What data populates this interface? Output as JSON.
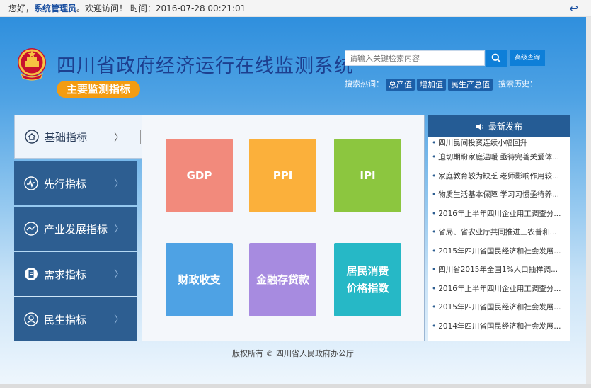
{
  "topbar": {
    "greeting": "您好，",
    "admin": "系统管理员",
    "welcome": "。欢迎访问！ 时间：",
    "time": "2016-07-28 00:21:01",
    "logout_icon": "↩"
  },
  "header": {
    "title": "四川省政府经济运行在线监测系统",
    "badge": "主要监测指标",
    "emblem_icon": "national-emblem-icon"
  },
  "search": {
    "placeholder": "请输入关键检索内容",
    "advanced_label": "高级查询",
    "hot_label": "搜索热词：",
    "hot_tags": [
      "总产值",
      "增加值",
      "民生产总值"
    ],
    "history_label": "搜索历史："
  },
  "nav": {
    "items": [
      {
        "label": "基础指标",
        "icon": "home-icon",
        "chevron": "〉"
      },
      {
        "label": "先行指标",
        "icon": "pulse-icon",
        "chevron": "〉"
      },
      {
        "label": "产业发展指标",
        "icon": "trend-icon",
        "chevron": "〉"
      },
      {
        "label": "需求指标",
        "icon": "document-icon",
        "chevron": "〉"
      },
      {
        "label": "民生指标",
        "icon": "user-icon",
        "chevron": "〉"
      }
    ]
  },
  "tiles": [
    {
      "label": "GDP",
      "color": "#f28a7c"
    },
    {
      "label": "PPI",
      "color": "#fbb03b"
    },
    {
      "label": "IPI",
      "color": "#8cc63f"
    },
    {
      "label": "财政收支",
      "color": "#4ea2e4"
    },
    {
      "label": "金融存贷款",
      "color": "#a78be0"
    },
    {
      "label": "居民消费价格指数",
      "color": "#26b8c6"
    }
  ],
  "news": {
    "title": "最新发布",
    "items": [
      "四川民间投资连续小幅回升",
      "迫切期盼家庭温暖 亟待完善关爱体...",
      "家庭教育较为缺乏 老师影响作用较...",
      "物质生活基本保障 学习习惯亟待养...",
      "2016年上半年四川企业用工调查分...",
      "省局、省农业厅共同推进三农普和...",
      "2015年四川省国民经济和社会发展...",
      "四川省2015年全国1%人口抽样调...",
      "2016年上半年四川企业用工调查分...",
      "2015年四川省国民经济和社会发展...",
      "2014年四川省国民经济和社会发展..."
    ]
  },
  "footer": {
    "text": "版权所有 © 四川省人民政府办公厅"
  }
}
